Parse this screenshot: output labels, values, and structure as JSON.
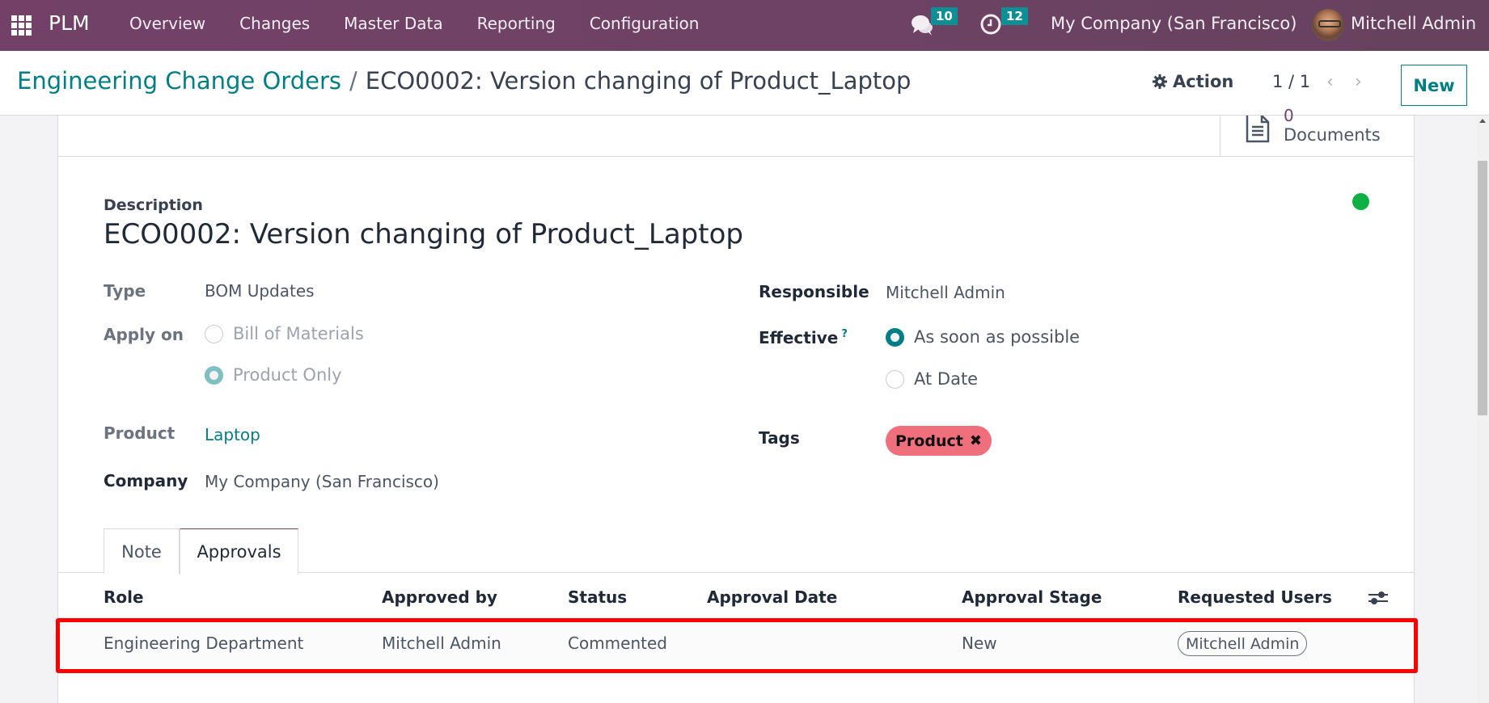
{
  "navbar": {
    "app_name": "PLM",
    "menu": [
      "Overview",
      "Changes",
      "Master Data",
      "Reporting",
      "Configuration"
    ],
    "messages_count": "10",
    "activities_count": "12",
    "company": "My Company (San Francisco)",
    "user": "Mitchell Admin",
    "icons": {
      "apps": "apps-grid-icon",
      "messages": "chat-icon",
      "activities": "clock-icon"
    }
  },
  "control_panel": {
    "breadcrumb_parent": "Engineering Change Orders",
    "breadcrumb_separator": "/",
    "breadcrumb_current": "ECO0002: Version changing of Product_Laptop",
    "action_label": "Action",
    "pager": "1 / 1",
    "prev": "‹",
    "next": "›",
    "new_label": "New"
  },
  "button_box": {
    "documents_count": "0",
    "documents_label": "Documents"
  },
  "status_color": "#0db143",
  "form": {
    "description_label": "Description",
    "title": "ECO0002: Version changing of Product_Laptop",
    "type_label": "Type",
    "type_value": "BOM Updates",
    "apply_on_label": "Apply on",
    "apply_on_options": [
      {
        "label": "Bill of Materials",
        "checked": false
      },
      {
        "label": "Product Only",
        "checked": true
      }
    ],
    "product_label": "Product",
    "product_value": "Laptop",
    "company_label": "Company",
    "company_value": "My Company (San Francisco)",
    "responsible_label": "Responsible",
    "responsible_value": "Mitchell Admin",
    "effective_label": "Effective",
    "effective_help": "?",
    "effective_options": [
      {
        "label": "As soon as possible",
        "checked": true
      },
      {
        "label": "At Date",
        "checked": false
      }
    ],
    "tags_label": "Tags",
    "tags": [
      {
        "label": "Product",
        "color": "#f06f7d",
        "remove": "✖"
      }
    ]
  },
  "tabs": [
    {
      "label": "Note",
      "active": false
    },
    {
      "label": "Approvals",
      "active": true
    }
  ],
  "approvals_table": {
    "columns": [
      "Role",
      "Approved by",
      "Status",
      "Approval Date",
      "Approval Stage",
      "Requested Users"
    ],
    "rows": [
      {
        "role": "Engineering Department",
        "approved_by": "Mitchell Admin",
        "status": "Commented",
        "approval_date": "",
        "approval_stage": "New",
        "requested_users": [
          "Mitchell Admin"
        ]
      }
    ]
  }
}
